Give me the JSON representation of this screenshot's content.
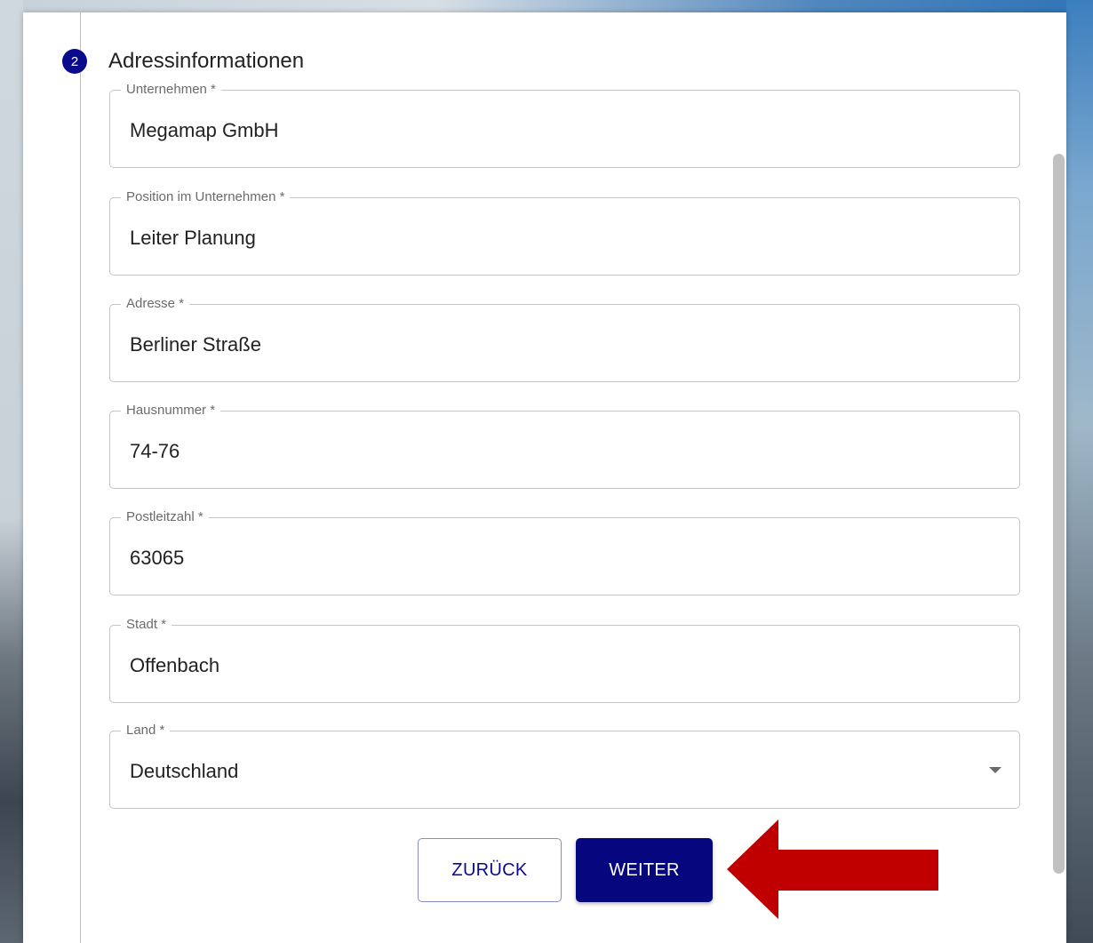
{
  "step": {
    "number": "2",
    "title": "Adressinformationen"
  },
  "fields": {
    "company": {
      "label": "Unternehmen *",
      "value": "Megamap GmbH"
    },
    "position": {
      "label": "Position im Unternehmen *",
      "value": "Leiter Planung"
    },
    "address": {
      "label": "Adresse *",
      "value": "Berliner Straße"
    },
    "house_number": {
      "label": "Hausnummer *",
      "value": "74-76"
    },
    "postal_code": {
      "label": "Postleitzahl *",
      "value": "63065"
    },
    "city": {
      "label": "Stadt *",
      "value": "Offenbach"
    },
    "country": {
      "label": "Land *",
      "value": "Deutschland"
    }
  },
  "buttons": {
    "back_label": "ZURÜCK",
    "next_label": "WEITER"
  },
  "colors": {
    "primary": "#06067e",
    "annotation_arrow": "#c00000"
  },
  "icons": {
    "dropdown": "chevron-down-icon",
    "annotation": "arrow-left-icon"
  }
}
